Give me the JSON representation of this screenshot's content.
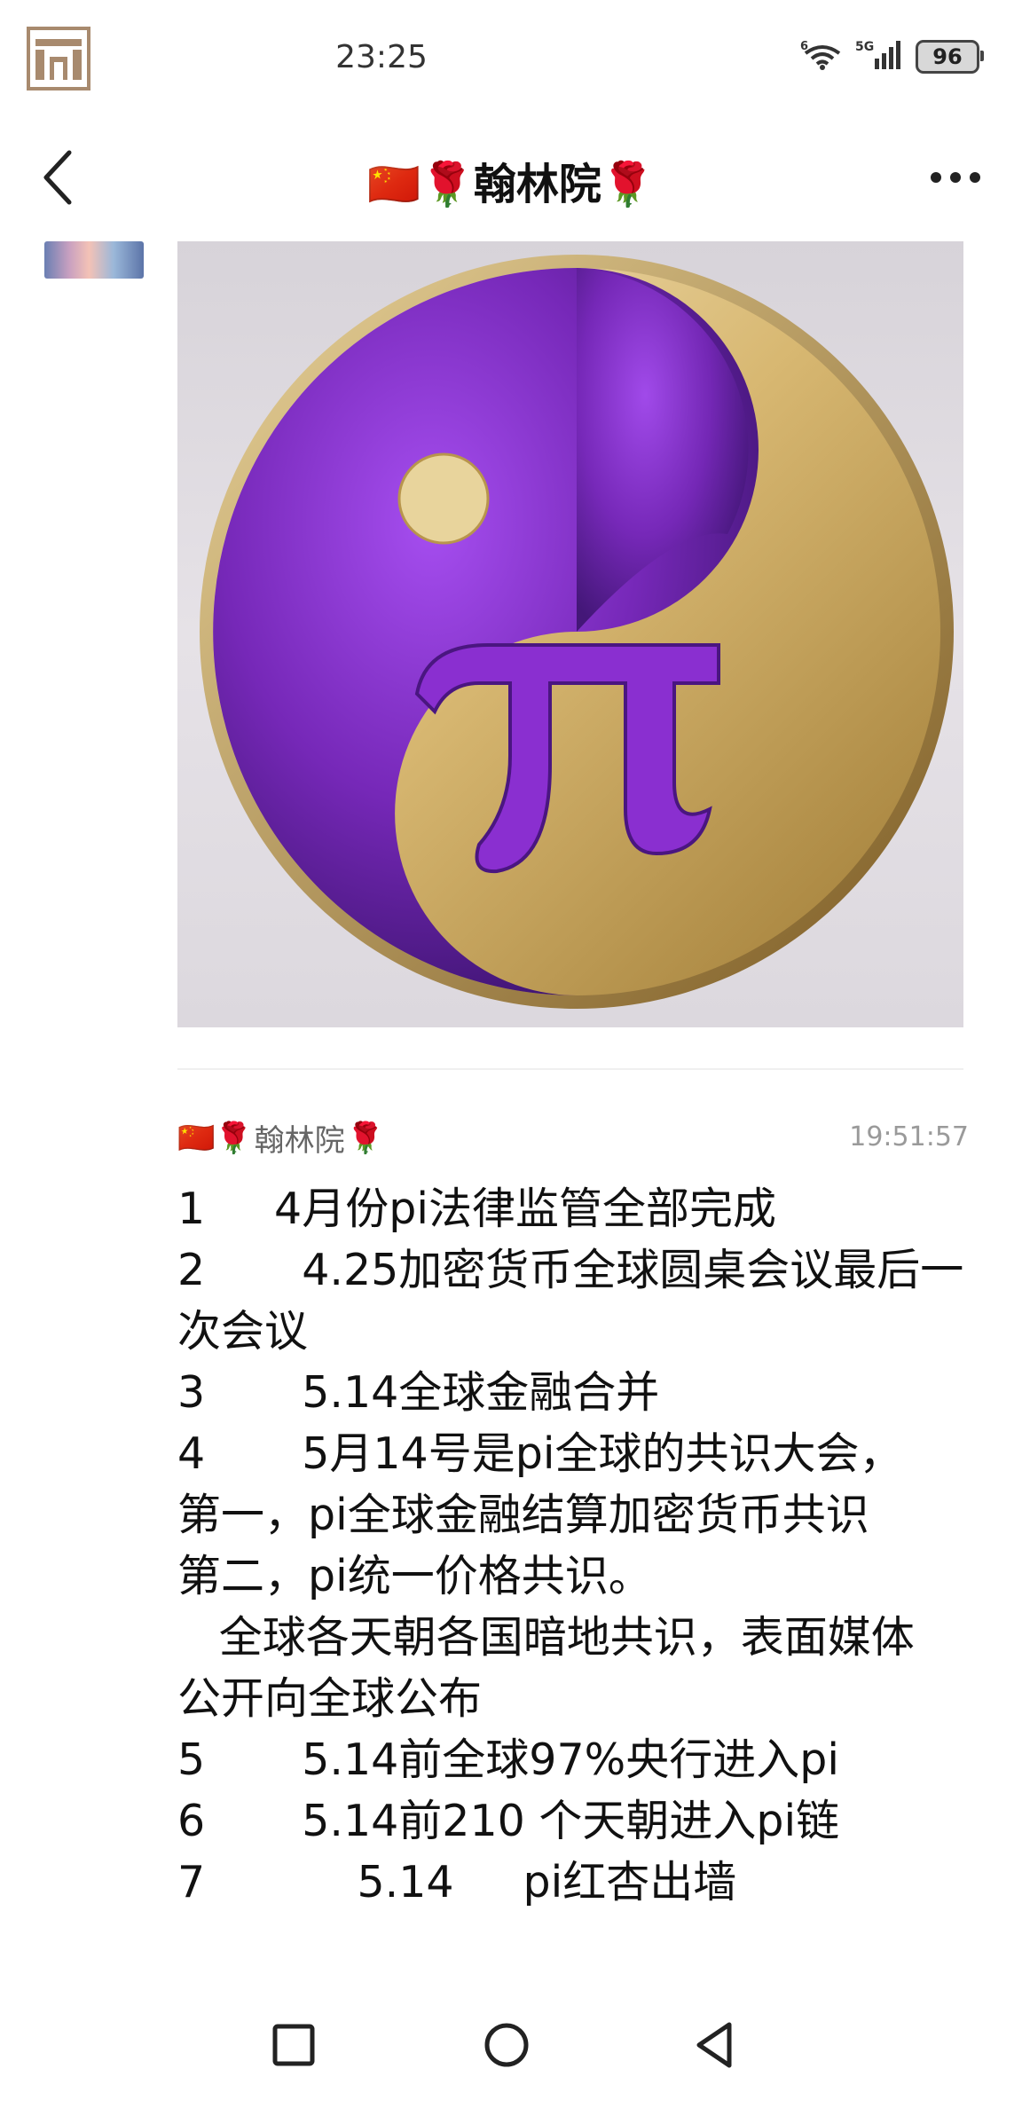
{
  "status_bar": {
    "time": "23:25",
    "network_label": "5G",
    "wifi_label": "6",
    "battery": "96"
  },
  "header": {
    "title": "翰林院",
    "title_emoji_left": "🇨🇳🌹",
    "title_emoji_right": "🌹",
    "back_icon": "chevron-left-icon",
    "more_icon": "more-horizontal-icon"
  },
  "post": {
    "image_description_icon": "pi-yin-yang-image",
    "colors": {
      "purple": "#7a2fbf",
      "gold": "#d8b872"
    }
  },
  "message": {
    "sender": "翰林院",
    "sender_emoji_left": "🇨🇳🌹",
    "sender_emoji_right": "🌹",
    "time": "19:51:57",
    "lines": [
      "1     4月份pi法律监管全部完成",
      "2       4.25加密货币全球圆桌会议最后一",
      "次会议",
      "3       5.14全球金融合并",
      "4       5月14号是pi全球的共识大会，",
      "第一，pi全球金融结算加密货币共识",
      "第二，pi统一价格共识。",
      "   全球各天朝各国暗地共识，表面媒体",
      "公开向全球公布",
      "5       5.14前全球97%央行进入pi",
      "6       5.14前210 个天朝进入pi链",
      "7           5.14     pi红杏出墙"
    ]
  },
  "nav_bar": {
    "recent_icon": "square-icon",
    "home_icon": "circle-icon",
    "back_icon": "triangle-back-icon"
  }
}
